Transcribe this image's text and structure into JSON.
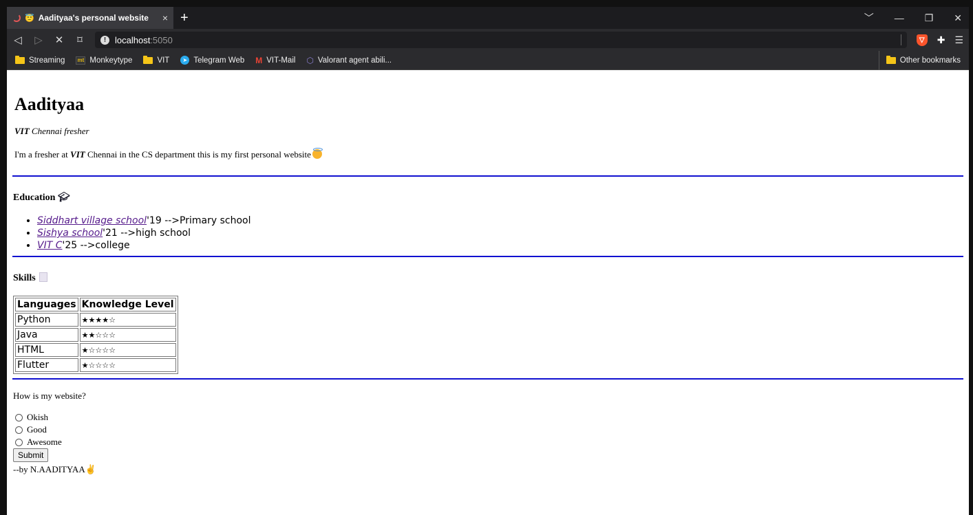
{
  "browser": {
    "tab_title": "Aadityaa's personal website",
    "tab_close": "×",
    "new_tab": "+",
    "url_host": "localhost",
    "url_port": ":5050",
    "window_controls": [
      "﹀",
      "—",
      "❐",
      "✕"
    ],
    "bookmarks": [
      {
        "label": "Streaming",
        "icon": "folder-icon"
      },
      {
        "label": "Monkeytype",
        "icon": "monkeytype-icon"
      },
      {
        "label": "VIT",
        "icon": "folder-icon"
      },
      {
        "label": "Telegram Web",
        "icon": "telegram-icon"
      },
      {
        "label": "VIT-Mail",
        "icon": "gmail-icon"
      },
      {
        "label": "Valorant agent abili...",
        "icon": "valorant-icon"
      }
    ],
    "other_bookmarks": "Other bookmarks"
  },
  "page": {
    "heading": "Aadityaa",
    "subtitle_bold": "VIT",
    "subtitle_rest": " Chennai fresher",
    "intro_start": "I'm a fresher at ",
    "intro_bold": "VIT",
    "intro_end": " Chennai in the CS department this is my first personal website",
    "education_heading": "Education",
    "education": [
      {
        "link": "Siddhart village school",
        "rest": "'19 -->Primary school"
      },
      {
        "link": "Sishya school",
        "rest": "'21 -->high school"
      },
      {
        "link": "VIT C",
        "rest": "'25 -->college"
      }
    ],
    "skills_heading": "Skills",
    "skills_table": {
      "headers": [
        "Languages",
        "Knowledge Level"
      ],
      "rows": [
        {
          "language": "Python",
          "stars": "★★★★☆",
          "rating": 4
        },
        {
          "language": "Java",
          "stars": "★★☆☆☆",
          "rating": 2
        },
        {
          "language": "HTML",
          "stars": "★☆☆☆☆",
          "rating": 1
        },
        {
          "language": "Flutter",
          "stars": "★☆☆☆☆",
          "rating": 1
        }
      ]
    },
    "question": "How is my website?",
    "options": [
      "Okish",
      "Good",
      "Awesome"
    ],
    "submit_label": "Submit",
    "footer": "--by N.AADITYAA"
  },
  "colors": {
    "divider": "#1010d0",
    "link_visited": "#551a8b",
    "tabstrip_bg": "#1c1c1f",
    "toolbar_bg": "#2b2b2e"
  }
}
